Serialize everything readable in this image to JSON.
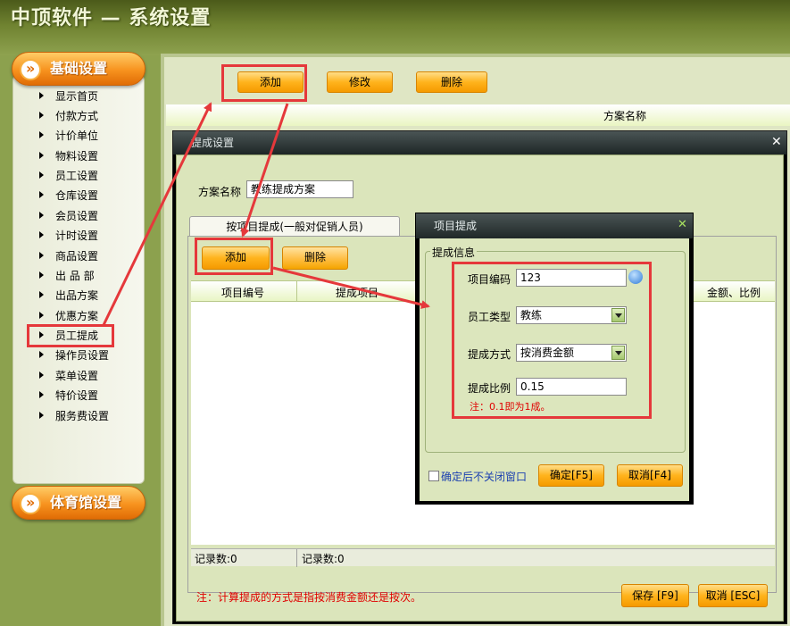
{
  "app": {
    "title": "中顶软件 — 系统设置"
  },
  "sidebar": {
    "section1": "基础设置",
    "items": [
      "显示首页",
      "付款方式",
      "计价单位",
      "物料设置",
      "员工设置",
      "仓库设置",
      "会员设置",
      "计时设置",
      "商品设置",
      "出 品 部",
      "出品方案",
      "优惠方案",
      "员工提成",
      "操作员设置",
      "菜单设置",
      "特价设置",
      "服务费设置"
    ],
    "section2": "体育馆设置"
  },
  "toolbar": {
    "add": "添加",
    "edit": "修改",
    "delete": "删除"
  },
  "main_table": {
    "col_name": "方案名称"
  },
  "dialog": {
    "title": "提成设置",
    "scheme_label": "方案名称",
    "scheme_value": "教练提成方案",
    "tab_label": "按项目提成(一般对促销人员)",
    "add": "添加",
    "delete": "删除",
    "columns": [
      "项目编号",
      "提成项目",
      "金额、比例"
    ],
    "count_left": "记录数:0",
    "count_right": "记录数:0",
    "note": "注：计算提成的方式是指按消费金额还是按次。",
    "save": "保存 [F9]",
    "cancel": "取消 [ESC]"
  },
  "subdialog": {
    "title": "项目提成",
    "group_label": "提成信息",
    "code_label": "项目编码",
    "code_value": "123",
    "type_label": "员工类型",
    "type_value": "教练",
    "method_label": "提成方式",
    "method_value": "按消费金额",
    "ratio_label": "提成比例",
    "ratio_value": "0.15",
    "hint": "注：0.1即为1成。",
    "keep_open": "确定后不关闭窗口",
    "ok": "确定[F5]",
    "cancel": "取消[F4]"
  },
  "colors": {
    "accent": "#f7921e",
    "annotation": "#e5383b"
  }
}
